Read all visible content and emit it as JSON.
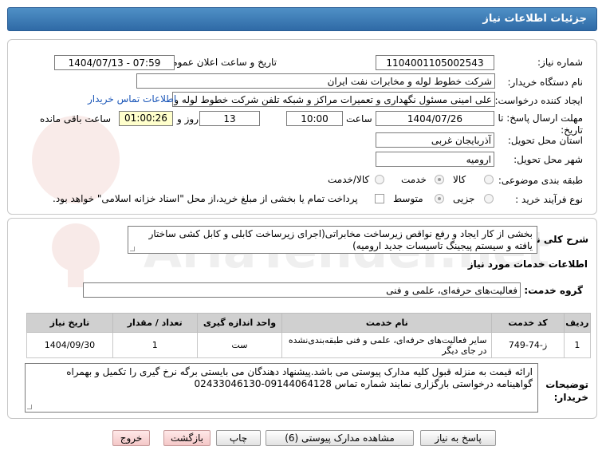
{
  "header": {
    "title": "جزئیات اطلاعات نیاز"
  },
  "form": {
    "need_number_label": "شماره نیاز:",
    "need_number": "1104001105002543",
    "announce_label": "تاریخ و ساعت اعلان عمومی:",
    "announce_value": "1404/07/13 - 07:59",
    "buyer_org_label": "نام دستگاه خریدار:",
    "buyer_org": "شرکت خطوط لوله و مخابرات نفت ایران",
    "creator_label": "ایجاد کننده درخواست:",
    "creator": "علی  امینی مسئول نگهداری و تعمیرات مراکز و شبکه تلفن شرکت خطوط لوله و",
    "contact_link": "اطلاعات تماس خریدار",
    "deadline_label": "مهلت ارسال پاسخ: تا تاریخ:",
    "deadline_date": "1404/07/26",
    "time_label": "ساعت",
    "deadline_time": "10:00",
    "days": "13",
    "days_label": "روز و",
    "remaining": "01:00:26",
    "remaining_label": "ساعت باقی مانده",
    "province_label": "استان محل تحویل:",
    "province": "آذربایجان غربی",
    "city_label": "شهر محل تحویل:",
    "city": "ارومیه",
    "category_label": "طبقه بندی موضوعی:",
    "category_options": [
      "کالا",
      "خدمت",
      "کالا/خدمت"
    ],
    "process_label": "نوع فرآیند خرید :",
    "process_options": [
      "جزیی",
      "متوسط"
    ],
    "payment_note": "پرداخت تمام یا بخشی از مبلغ خرید،از محل \"اسناد خزانه اسلامی\" خواهد بود."
  },
  "need": {
    "desc_label": "شرح کلی نیاز:",
    "desc": "بخشی از کار ایجاد و رفع نواقص زیرساخت مخابراتی(اجرای زیرساخت کابلی و کابل کشی ساختار یافته و سیستم پیجینگ تاسیسات جدید ارومیه)",
    "services_title": "اطلاعات خدمات مورد نیاز",
    "service_group_label": "گروه خدمت:",
    "service_group": "فعالیت‌های حرفه‌ای، علمی و فنی"
  },
  "table": {
    "headers": [
      "ردیف",
      "کد خدمت",
      "نام خدمت",
      "واحد اندازه گیری",
      "تعداد / مقدار",
      "تاریخ نیاز"
    ],
    "rows": [
      [
        "1",
        "ز-74-749",
        "سایر فعالیت‌های حرفه‌ای، علمی و فنی طبقه‌بندی‌نشده در جای دیگر",
        "ست",
        "1",
        "1404/09/30"
      ]
    ]
  },
  "buyer_notes": {
    "label": "توضیحات خریدار:",
    "text": "ارائه قیمت به منزله قبول کلیه مدارک پیوستی می باشد.پیشنهاد دهندگان می بایستی برگه نرخ گیری را تکمیل و بهمراه گواهینامه درخواستی بارگزاری نمایند  شماره تماس 09144064128-02433046130"
  },
  "buttons": {
    "reply": "پاسخ به نیاز",
    "attachments": "مشاهده مدارک پیوستی (6)",
    "print": "چاپ",
    "back": "بازگشت",
    "exit": "خروج"
  },
  "watermark_text": "AriaTender.net",
  "colors": {
    "header": "#3a78b5",
    "timer_bg": "#ffffcc",
    "link": "#1a56b8",
    "exit_btn": "#f4c7c7"
  }
}
